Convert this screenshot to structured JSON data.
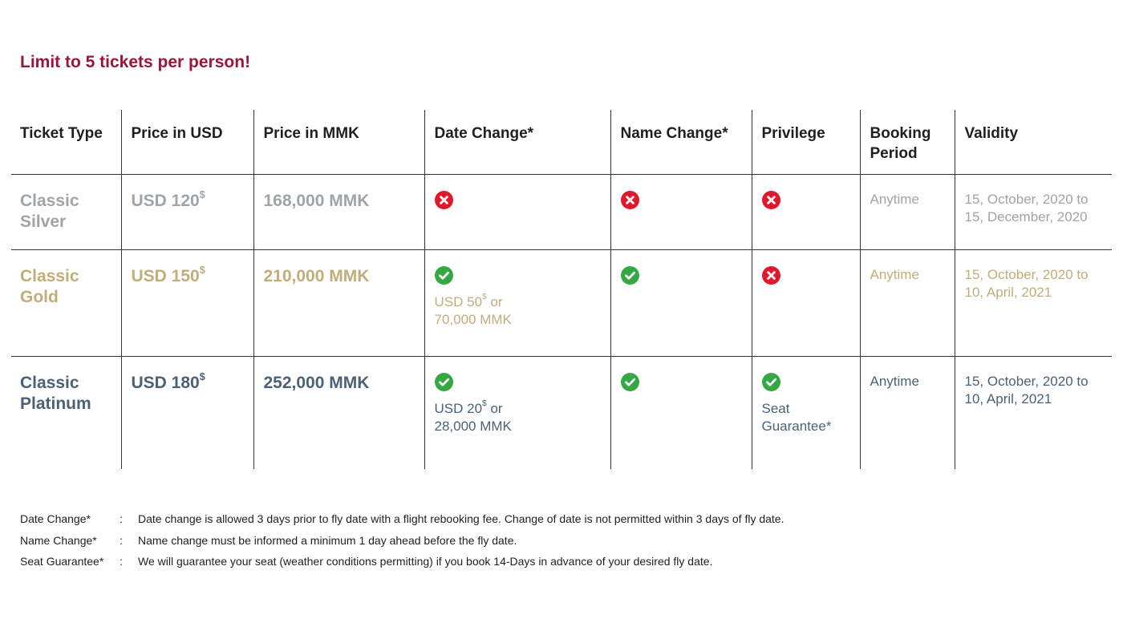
{
  "notice": {
    "limit_text": "Limit to 5 tickets per person!",
    "accent_color": "#9b1538"
  },
  "table": {
    "headers": {
      "ticket_type": "Ticket Type",
      "price_usd": "Price in USD",
      "price_mmk": "Price in MMK",
      "date_change": "Date Change*",
      "name_change": "Name Change*",
      "privilege": "Privilege",
      "booking_period": "Booking Period",
      "validity": "Validity"
    },
    "rows": [
      {
        "tier": "Classic Silver",
        "tone_color": "#9ea4a8",
        "price_usd": "USD 120",
        "price_usd_symbol": "$",
        "price_mmk": "168,000 MMK",
        "date_change": {
          "status": "cross-icon",
          "fee_usd": "",
          "fee_symbol": "",
          "fee_rest": ""
        },
        "name_change": {
          "status": "cross-icon"
        },
        "privilege": {
          "status": "cross-icon",
          "text": ""
        },
        "booking_period": "Anytime",
        "validity": "15, October, 2020 to 15, December, 2020"
      },
      {
        "tier": "Classic Gold",
        "tone_color": "#c2ad7a",
        "price_usd": "USD 150",
        "price_usd_symbol": "$",
        "price_mmk": "210,000 MMK",
        "date_change": {
          "status": "check-icon",
          "fee_usd": "USD 50",
          "fee_symbol": "$",
          "fee_rest": " or 70,000 MMK"
        },
        "name_change": {
          "status": "check-icon"
        },
        "privilege": {
          "status": "cross-icon",
          "text": ""
        },
        "booking_period": "Anytime",
        "validity": "15, October, 2020 to 10, April, 2021"
      },
      {
        "tier": "Classic Platinum",
        "tone_color": "#4a6277",
        "price_usd": "USD 180",
        "price_usd_symbol": "$",
        "price_mmk": "252,000 MMK",
        "date_change": {
          "status": "check-icon",
          "fee_usd": "USD 20",
          "fee_symbol": "$",
          "fee_rest": " or 28,000 MMK"
        },
        "name_change": {
          "status": "check-icon"
        },
        "privilege": {
          "status": "check-icon",
          "text": "Seat Guarantee*"
        },
        "booking_period": "Anytime",
        "validity": "15, October, 2020 to 10, April, 2021"
      }
    ],
    "status_colors": {
      "check": "#34a843",
      "cross": "#e0182d"
    }
  },
  "footnotes": [
    {
      "term": "Date Change*",
      "separator": ":",
      "text": "Date change is allowed 3 days prior to fly date with a flight rebooking fee. Change of date is not permitted within 3 days of fly date."
    },
    {
      "term": "Name Change*",
      "separator": ":",
      "text": "Name change must be informed a minimum 1 day ahead before the fly date."
    },
    {
      "term": "Seat Guarantee*",
      "separator": ":",
      "text": "We will guarantee your seat (weather conditions permitting) if you book 14-Days in advance of your desired fly date."
    }
  ]
}
